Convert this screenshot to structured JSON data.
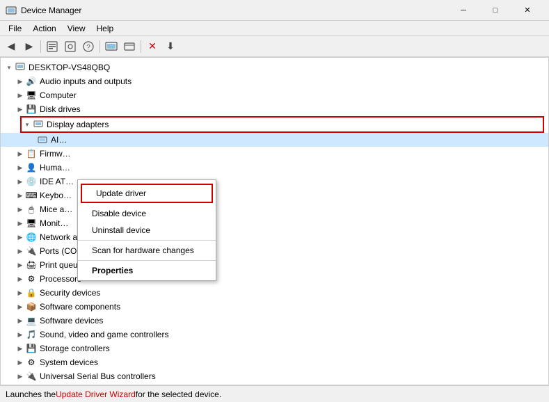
{
  "window": {
    "title": "Device Manager",
    "icon": "⚙"
  },
  "titlebar_buttons": {
    "minimize": "─",
    "maximize": "□",
    "close": "✕"
  },
  "menubar": {
    "items": [
      "File",
      "Action",
      "View",
      "Help"
    ]
  },
  "toolbar": {
    "buttons": [
      "◀",
      "▶",
      "📋",
      "📋",
      "❓",
      "📋",
      "🖥",
      "📋",
      "✕",
      "⬇"
    ]
  },
  "tree": {
    "root": "DESKTOP-VS48QBQ",
    "items": [
      {
        "label": "Audio inputs and outputs",
        "indent": 1,
        "icon": "🔊",
        "expanded": false
      },
      {
        "label": "Computer",
        "indent": 1,
        "icon": "🖥",
        "expanded": false
      },
      {
        "label": "Disk drives",
        "indent": 1,
        "icon": "💾",
        "expanded": false
      },
      {
        "label": "Display adapters",
        "indent": 1,
        "icon": "🖥",
        "expanded": true,
        "highlighted": true
      },
      {
        "label": "AI…",
        "indent": 2,
        "icon": "📺",
        "selected": true
      },
      {
        "label": "Firmw…",
        "indent": 1,
        "icon": "📋",
        "expanded": false
      },
      {
        "label": "Huma…",
        "indent": 1,
        "icon": "👤",
        "expanded": false
      },
      {
        "label": "IDE AT…",
        "indent": 1,
        "icon": "💿",
        "expanded": false
      },
      {
        "label": "Keybo…",
        "indent": 1,
        "icon": "⌨",
        "expanded": false
      },
      {
        "label": "Mice a…",
        "indent": 1,
        "icon": "🖱",
        "expanded": false
      },
      {
        "label": "Monit…",
        "indent": 1,
        "icon": "🖥",
        "expanded": false
      },
      {
        "label": "Network adapters",
        "indent": 1,
        "icon": "🌐",
        "expanded": false
      },
      {
        "label": "Ports (COM & LPT)",
        "indent": 1,
        "icon": "🔌",
        "expanded": false
      },
      {
        "label": "Print queues",
        "indent": 1,
        "icon": "🖨",
        "expanded": false
      },
      {
        "label": "Processors",
        "indent": 1,
        "icon": "⚙",
        "expanded": false
      },
      {
        "label": "Security devices",
        "indent": 1,
        "icon": "🔒",
        "expanded": false
      },
      {
        "label": "Software components",
        "indent": 1,
        "icon": "📦",
        "expanded": false
      },
      {
        "label": "Software devices",
        "indent": 1,
        "icon": "💻",
        "expanded": false
      },
      {
        "label": "Sound, video and game controllers",
        "indent": 1,
        "icon": "🎵",
        "expanded": false
      },
      {
        "label": "Storage controllers",
        "indent": 1,
        "icon": "💾",
        "expanded": false
      },
      {
        "label": "System devices",
        "indent": 1,
        "icon": "⚙",
        "expanded": false
      },
      {
        "label": "Universal Serial Bus controllers",
        "indent": 1,
        "icon": "🔌",
        "expanded": false
      }
    ]
  },
  "context_menu": {
    "items": [
      {
        "label": "Update driver",
        "type": "update"
      },
      {
        "label": "Disable device",
        "type": "normal"
      },
      {
        "label": "Uninstall device",
        "type": "normal"
      },
      {
        "label": "sep"
      },
      {
        "label": "Scan for hardware changes",
        "type": "normal"
      },
      {
        "label": "sep"
      },
      {
        "label": "Properties",
        "type": "bold"
      }
    ]
  },
  "statusbar": {
    "text_before": "Launches the ",
    "text_highlight": "Update Driver Wizard",
    "text_after": " for the selected device."
  }
}
